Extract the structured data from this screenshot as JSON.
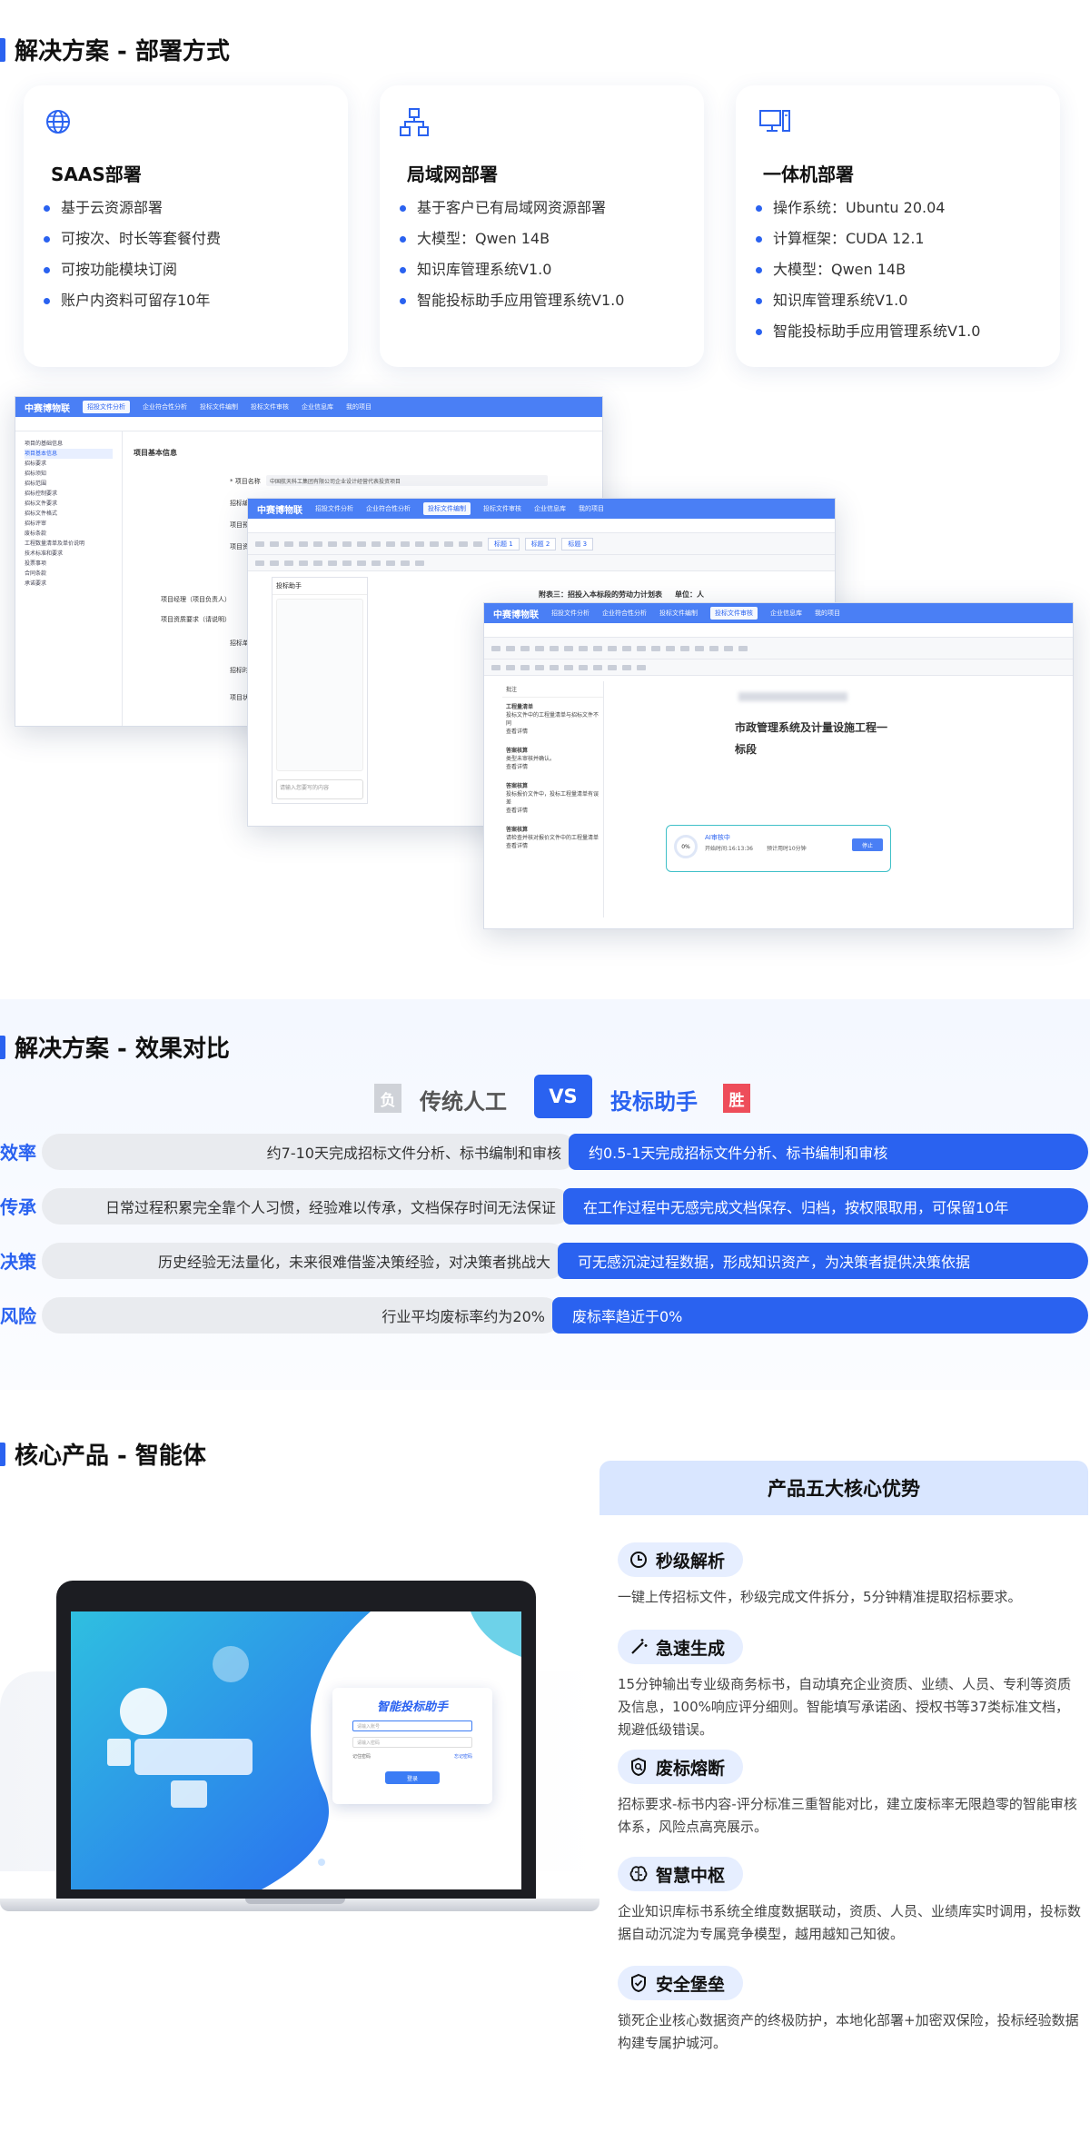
{
  "deploy": {
    "title": "解决方案 - 部署方式",
    "cards": [
      {
        "title": "SAAS部署",
        "icon": "globe-icon",
        "items": [
          "基于云资源部署",
          "可按次、时长等套餐付费",
          "可按功能模块订阅",
          "账户内资料可留存10年"
        ]
      },
      {
        "title": "局域网部署",
        "icon": "network-icon",
        "items": [
          "基于客户已有局域网资源部署",
          "大模型：Qwen 14B",
          "知识库管理系统V1.0",
          "智能投标助手应用管理系统V1.0"
        ]
      },
      {
        "title": "一体机部署",
        "icon": "computer-icon",
        "items": [
          "操作系统：Ubuntu 20.04",
          "计算框架：CUDA 12.1",
          "大模型：Qwen 14B",
          "知识库管理系统V1.0",
          "智能投标助手应用管理系统V1.0"
        ]
      }
    ]
  },
  "screens": {
    "logo": "中赛博物联",
    "menu": [
      "招投文件分析",
      "企业符合性分析",
      "投标文件编制",
      "投标文件审核",
      "企业信息库",
      "我的项目"
    ],
    "w1_section": "项目基本信息",
    "w1_sidebar": [
      "项目的基础信息",
      "项目基本信息",
      "招标要求",
      "招标须知",
      "招标范围",
      "招标控制要求",
      "招标文件要求",
      "招标文件格式",
      "招标评审",
      "废标条款",
      "工程数量清单及单价说明",
      "技术标准和要求",
      "投票事项",
      "合同条款",
      "承诺要求"
    ],
    "w1_labels": [
      "* 项目名称",
      "招标编号",
      "项目预算",
      "项目资金来源",
      "项目经理（项目负责人）",
      "项目资质要求（请说明）",
      "招标单位",
      "招标时间",
      "项目状态"
    ],
    "w1_value": "中国航天科工集团有限公司企业设计经营代表投资项目",
    "w2_assistant": "投标助手",
    "w2_placeholder": "请输入您要写的内容",
    "w2_doc_title": "附表三：招投入本标段的劳动力计划表",
    "w2_doc_unit": "单位：人",
    "w3_comments": [
      {
        "name": "工程量清单",
        "text": "投标文件中的工程量清单与招标文件不同",
        "act": "查看详情"
      },
      {
        "name": "答案核算",
        "text": "类型未审核并确认。",
        "act": "查看详情"
      },
      {
        "name": "答案核算",
        "text": "投标报价文件中，投标工程量清单有误差",
        "act": "查看详情"
      },
      {
        "name": "答案核算",
        "text": "请检查并核对报价文件中的工程量清单",
        "act": "查看详情"
      }
    ],
    "w3_doc_line1": "市政管理系统及计量设施工程一",
    "w3_doc_line2": "标段",
    "w3_ai": "AI审核中",
    "w3_ai_time": "开始时间:16:13:36",
    "w3_ai_eta": "预计用时10分钟",
    "w3_ai_stop": "停止",
    "w3_ai_pct": "0%",
    "w3_comment_title": "批注"
  },
  "compare": {
    "title": "解决方案 - 效果对比",
    "lose_badge": "负",
    "left_title": "传统人工",
    "vs": "VS",
    "right_title": "投标助手",
    "win_badge": "胜",
    "rows": [
      {
        "label": "效率",
        "left": "约7-10天完成招标文件分析、标书编制和审核",
        "right": "约0.5-1天完成招标文件分析、标书编制和审核"
      },
      {
        "label": "传承",
        "left": "日常过程积累完全靠个人习惯，经验难以传承，文档保存时间无法保证",
        "right": "在工作过程中无感完成文档保存、归档，按权限取用，可保留10年"
      },
      {
        "label": "决策",
        "left": "历史经验无法量化，未来很难借鉴决策经验，对决策者挑战大",
        "right": "可无感沉淀过程数据，形成知识资产，为决策者提供决策依据"
      },
      {
        "label": "风险",
        "left": "行业平均废标率约为20%",
        "right": "废标率趋近于0%"
      }
    ]
  },
  "product": {
    "title": "核心产品 - 智能体",
    "login_title": "智能投标助手",
    "login_user_ph": "请输入账号",
    "login_pw_ph": "请输入密码",
    "login_remember": "记住密码",
    "login_forgot": "忘记密码",
    "login_btn": "登录",
    "adv_title": "产品五大核心优势",
    "advantages": [
      {
        "name": "秒级解析",
        "icon": "clock-icon",
        "desc": "一键上传招标文件，秒级完成文件拆分，5分钟精准提取招标要求。"
      },
      {
        "name": "急速生成",
        "icon": "magic-wand-icon",
        "desc": "15分钟输出专业级商务标书，自动填充企业资质、业绩、人员、专利等资质及信息，100%响应评分细则。智能填写承诺函、授权书等37类标准文档，规避低级错误。"
      },
      {
        "name": "废标熔断",
        "icon": "shield-search-icon",
        "desc": "招标要求-标书内容-评分标准三重智能对比，建立废标率无限趋零的智能审核体系，风险点高亮展示。"
      },
      {
        "name": "智慧中枢",
        "icon": "brain-icon",
        "desc": "企业知识库标书系统全维度数据联动，资质、人员、业绩库实时调用，投标数据自动沉淀为专属竞争模型，越用越知己知彼。"
      },
      {
        "name": "安全堡垒",
        "icon": "shield-check-icon",
        "desc": "锁死企业核心数据资产的终极防护，本地化部署+加密双保险，投标经验数据构建专属护城河。"
      }
    ]
  }
}
